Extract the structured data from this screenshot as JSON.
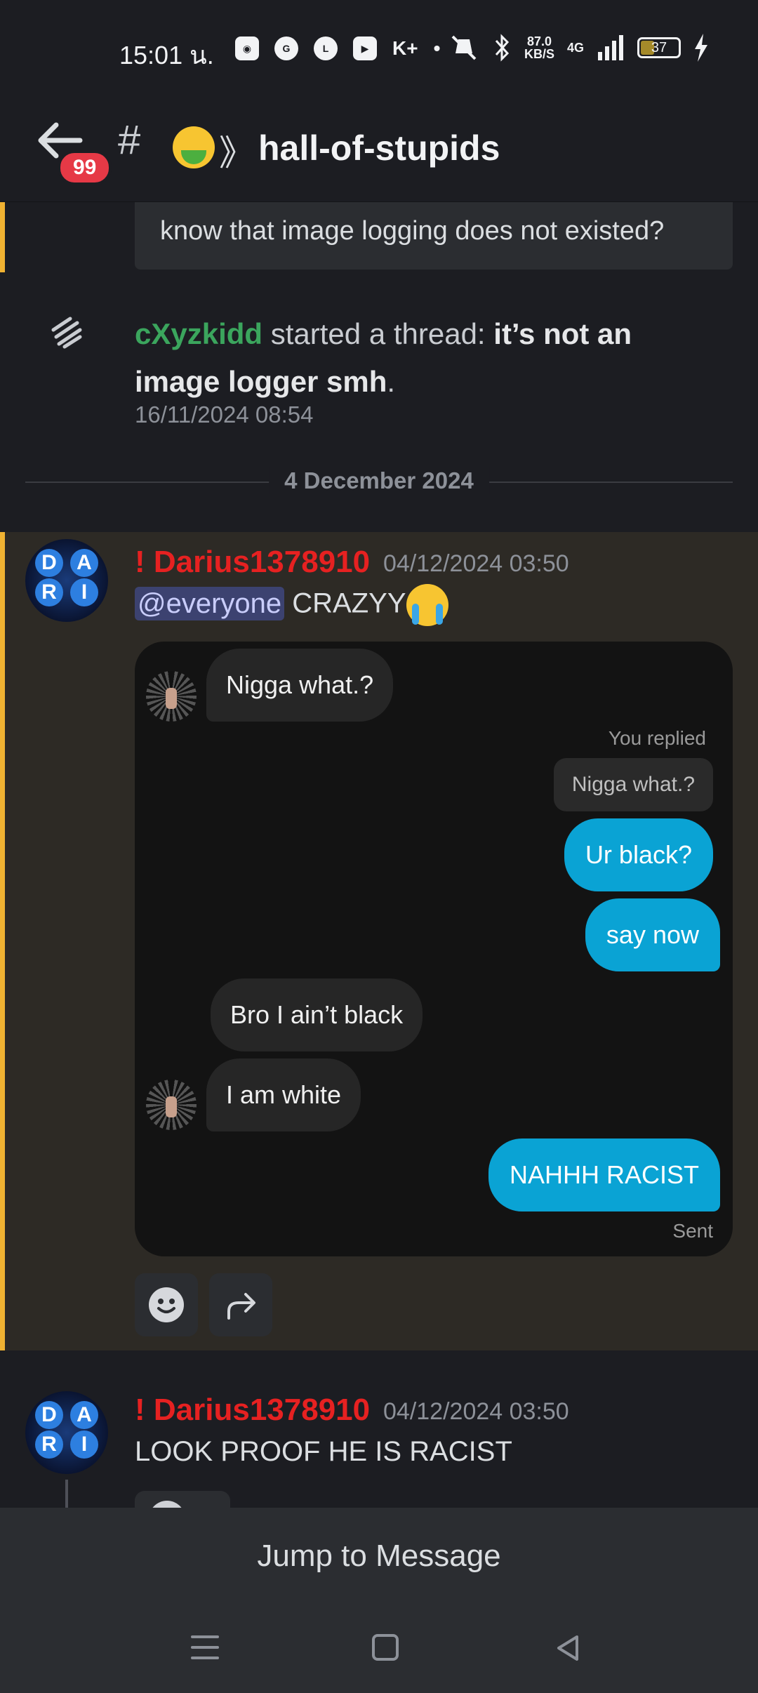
{
  "status_bar": {
    "time": "15:01 น.",
    "left_icons": [
      "discord-icon",
      "google-icon",
      "line-icon",
      "youtube-icon",
      "k-plus-icon",
      "dot-icon"
    ],
    "net_speed_value": "87.0",
    "net_speed_unit": "KB/S",
    "network": "4G",
    "battery": "37",
    "battery_level": 0.37
  },
  "header": {
    "badge": "99",
    "hash": "#",
    "arrows": "》",
    "channel_name": "hall-of-stupids"
  },
  "reply_preview": {
    "text": "know that image logging does not existed?"
  },
  "thread_event": {
    "user": "cXyzkidd",
    "action": " started a thread: ",
    "thread_title": "it’s not an image logger smh",
    "suffix": ".",
    "timestamp": "16/11/2024 08:54"
  },
  "date_divider": "4 December 2024",
  "message1": {
    "avatar_letters": [
      "D",
      "A",
      "R",
      "I"
    ],
    "username": "! Darius1378910",
    "timestamp": "04/12/2024 03:50",
    "mention": "@everyone",
    "text": " CRAZYY",
    "screenshot": {
      "msg_in_1": "Nigga what.?",
      "you_replied": "You replied",
      "quoted": "Nigga what.?",
      "msg_out_1": "Ur black?",
      "msg_out_2": "say now",
      "msg_in_2": "Bro I ain’t black",
      "msg_in_3": "I am white",
      "msg_out_3": "NAHHH RACIST",
      "sent": "Sent"
    },
    "actions": [
      "add-reaction-icon",
      "forward-icon"
    ]
  },
  "message2": {
    "avatar_letters": [
      "D",
      "A",
      "R",
      "I"
    ],
    "username": "! Darius1378910",
    "timestamp": "04/12/2024 03:50",
    "text": "LOOK PROOF HE IS RACIST"
  },
  "jump_bar": {
    "label": "Jump to Message"
  },
  "colors": {
    "background": "#1c1d22",
    "highlight": "#2d2a25",
    "highlight_bar": "#f0b232",
    "username_red": "#e62121",
    "username_green": "#3ba55d",
    "bubble_blue": "#0aa3d4"
  }
}
